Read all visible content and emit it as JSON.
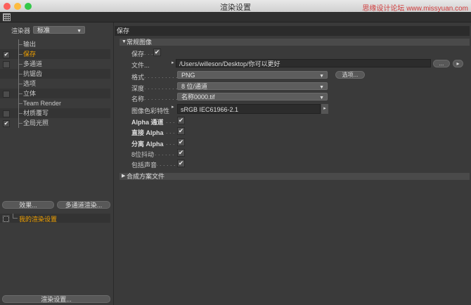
{
  "window": {
    "title": "渲染设置",
    "watermark": "思缘设计论坛  www.missyuan.com",
    "traffic_lights": [
      "#fc605c",
      "#fdbc40",
      "#34c84a"
    ]
  },
  "left": {
    "renderer_label": "渲染器",
    "renderer_value": "标准",
    "items": [
      {
        "label": "输出",
        "checkbox": "none"
      },
      {
        "label": "保存",
        "checkbox": "checked",
        "selected": true
      },
      {
        "label": "多通道",
        "checkbox": "unchecked"
      },
      {
        "label": "抗锯齿",
        "checkbox": "none"
      },
      {
        "label": "选项",
        "checkbox": "none"
      },
      {
        "label": "立体",
        "checkbox": "unchecked"
      },
      {
        "label": "Team Render",
        "checkbox": "none"
      },
      {
        "label": "材质覆写",
        "checkbox": "unchecked"
      },
      {
        "label": "全局光照",
        "checkbox": "checked"
      }
    ],
    "effects_button": "效果...",
    "multipass_button": "多通道渲染...",
    "preset_name": "我的渲染设置",
    "render_settings_button": "渲染设置..."
  },
  "right": {
    "header": "保存",
    "section_general": "常规图像",
    "save_label": "保存",
    "save_checked": "✔",
    "file_label": "文件...",
    "file_path": "/Users/willeson/Desktop/你可以更好",
    "browse_button": "...",
    "play_icon": "▸",
    "format_label": "格式",
    "format_value": "PNG",
    "options_button": "选项...",
    "depth_label": "深度",
    "depth_value": "8 位/通道",
    "name_label": "名称",
    "name_value": "名称0000.tif",
    "profile_label": "图像色彩特性",
    "profile_value": "sRGB IEC61966-2.1",
    "alpha_label": "Alpha 通道",
    "straight_alpha_label": "直接 Alpha",
    "separate_alpha_label": "分离 Alpha",
    "dither_label": "8位抖动",
    "sound_label": "包括声音",
    "check_mark": "✔",
    "section_composite": "合成方案文件",
    "dots_short": ". . . . . . . . . .",
    "dots_tiny": ". . .",
    "dots_mid": ". . . . . ."
  }
}
